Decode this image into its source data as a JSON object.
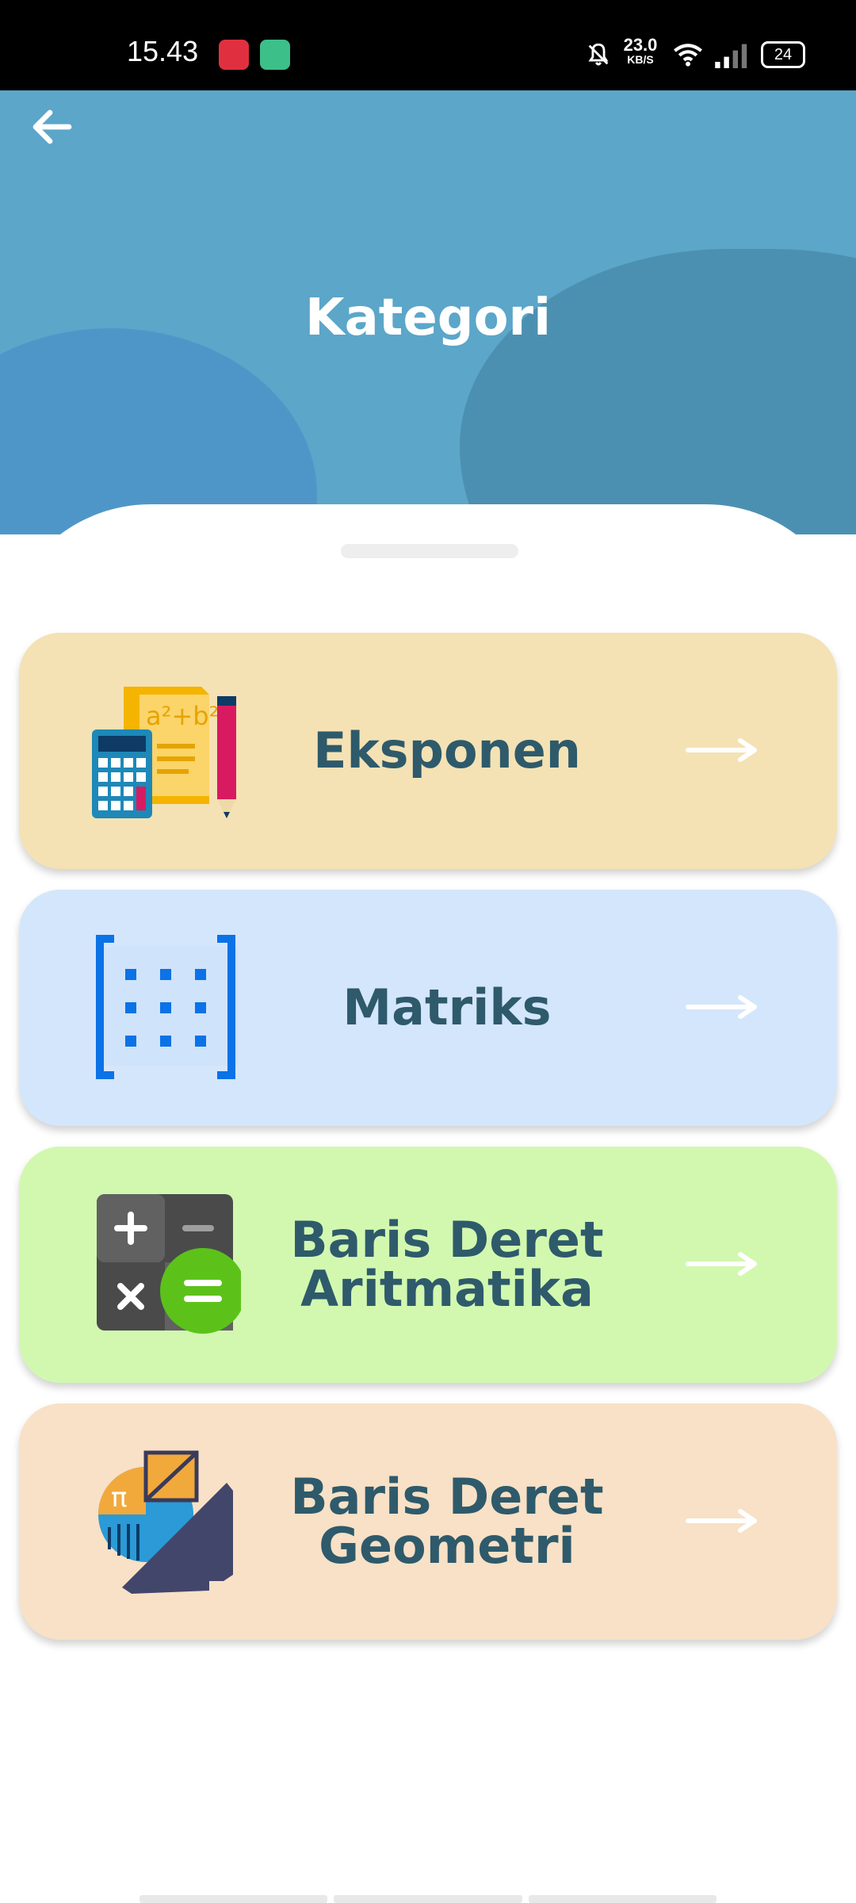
{
  "status_bar": {
    "time": "15.43",
    "net_speed_value": "23.0",
    "net_speed_unit": "KB/S",
    "battery": "24"
  },
  "header": {
    "title": "Kategori",
    "bg_color": "#5ba6c9"
  },
  "categories": [
    {
      "label": "Eksponen",
      "icon": "calculator-formula-icon",
      "color": "#f4e2b4"
    },
    {
      "label": "Matriks",
      "icon": "matrix-icon",
      "color": "#d4e6fb"
    },
    {
      "label": "Baris Deret\nAritmatika",
      "icon": "arithmetic-calculator-icon",
      "color": "#d2f8b0"
    },
    {
      "label": "Baris Deret\nGeometri",
      "icon": "geometry-icon",
      "color": "#f8e1c6"
    }
  ]
}
